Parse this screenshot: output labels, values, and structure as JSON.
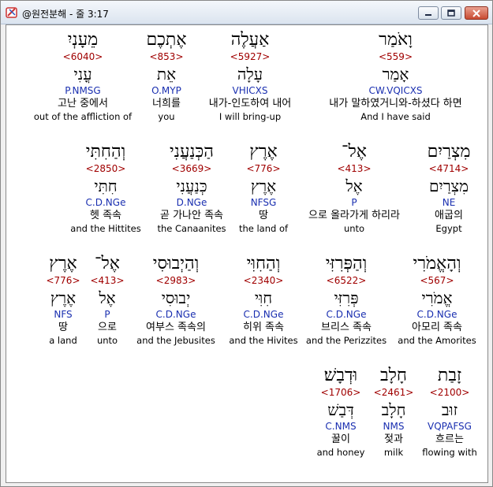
{
  "window": {
    "title": "@원전분해 - 줄 3:17",
    "controls": {
      "minimize": "minimize-icon",
      "maximize": "maximize-icon",
      "close": "close-icon"
    }
  },
  "rows": [
    {
      "words": [
        {
          "heb": "מֵעָנְיִ",
          "strong": "<6040>",
          "lemma": "עֳנִי",
          "morph": "P.NMSG",
          "ko": "고난 중에서",
          "en": "out of the affliction of"
        },
        {
          "heb": "אֶתְכֶם",
          "strong": "<853>",
          "lemma": "אֵת",
          "morph": "O.MYP",
          "ko": "너희를",
          "en": "you"
        },
        {
          "heb": "אַעֲלֶה",
          "strong": "<5927>",
          "lemma": "עָלָה",
          "morph": "VHICXS",
          "ko": "내가-인도하여 내어",
          "en": "I will bring-up"
        },
        {
          "heb": "וָאֹמַר",
          "strong": "<559>",
          "lemma": "אָמַר",
          "morph": "CW.VQICXS",
          "ko": "내가 말하였거니와-하셨다 하면",
          "en": "And I have said"
        }
      ]
    },
    {
      "words": [
        {
          "heb": "וְהַחִתִּי",
          "strong": "<2850>",
          "lemma": "חִתִּי",
          "morph": "C.D.NGe",
          "ko": "헷 족속",
          "en": "and the Hittites"
        },
        {
          "heb": "הַכְּנַעֲנִי",
          "strong": "<3669>",
          "lemma": "כְּנַעֲנִי",
          "morph": "D.NGe",
          "ko": "곧 가나안 족속",
          "en": "the Canaanites"
        },
        {
          "heb": "אֶרֶץ",
          "strong": "<776>",
          "lemma": "אֶרֶץ",
          "morph": "NFSG",
          "ko": "땅",
          "en": "the land of"
        },
        {
          "heb": "אֶל־",
          "strong": "<413>",
          "lemma": "אֶל",
          "morph": "P",
          "ko": "으로 올라가게 하리라",
          "en": "unto"
        },
        {
          "heb": "מִצְרַיִם",
          "strong": "<4714>",
          "lemma": "מִצְרַיִם",
          "morph": "NE",
          "ko": "애굽의",
          "en": "Egypt"
        }
      ]
    },
    {
      "words": [
        {
          "heb": "אֶרֶץ",
          "strong": "<776>",
          "lemma": "אֶרֶץ",
          "morph": "NFS",
          "ko": "땅",
          "en": "a land"
        },
        {
          "heb": "אֶל־",
          "strong": "<413>",
          "lemma": "אֶל",
          "morph": "P",
          "ko": "으로",
          "en": "unto"
        },
        {
          "heb": "וְהַיְבוּסִי",
          "strong": "<2983>",
          "lemma": "יְבוּסִי",
          "morph": "C.D.NGe",
          "ko": "여부스 족속의",
          "en": "and the Jebusites"
        },
        {
          "heb": "וְהַחִוִּי",
          "strong": "<2340>",
          "lemma": "חִוִּי",
          "morph": "C.D.NGe",
          "ko": "히위 족속",
          "en": "and the Hivites"
        },
        {
          "heb": "וְהַפְּרִזִּי",
          "strong": "<6522>",
          "lemma": "פְּרִזִּי",
          "morph": "C.D.NGe",
          "ko": "브리스 족속",
          "en": "and the Perizzites"
        },
        {
          "heb": "וְהָאֱמֹרִי",
          "strong": "<567>",
          "lemma": "אֱמֹרִי",
          "morph": "C.D.NGe",
          "ko": "아모리 족속",
          "en": "and the Amorites"
        }
      ]
    },
    {
      "words": [
        {
          "heb": "וּדְבָשׁ׃",
          "strong": "<1706>",
          "lemma": "דְּבַשׁ",
          "morph": "C.NMS",
          "ko": "꿀이",
          "en": "and honey"
        },
        {
          "heb": "חָלָב",
          "strong": "<2461>",
          "lemma": "חָלָב",
          "morph": "NMS",
          "ko": "젖과",
          "en": "milk"
        },
        {
          "heb": "זָבַת",
          "strong": "<2100>",
          "lemma": "זוּב",
          "morph": "VQPAFSG",
          "ko": "흐르는",
          "en": "flowing with"
        }
      ]
    }
  ]
}
